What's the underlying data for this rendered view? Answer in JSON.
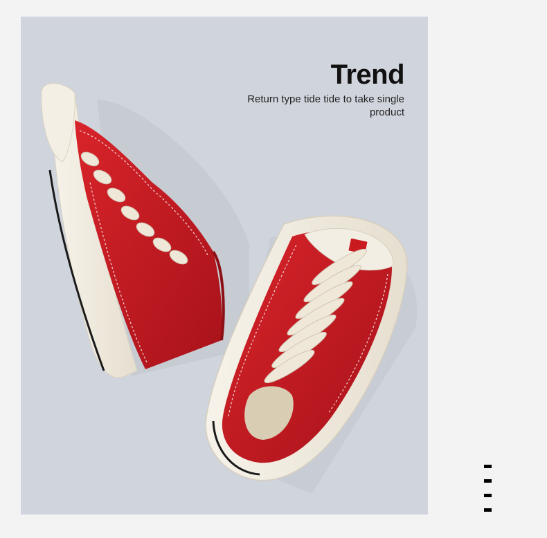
{
  "headline": "Trend",
  "tagline": "Return type tide tide to take single product",
  "colors": {
    "page_background": "#f3f3f3",
    "panel_background": "#d0d4dc",
    "shoe_red": "#c91a1f",
    "sole_cream": "#f3eee3",
    "lace_cream": "#efe7d8"
  },
  "photo": {
    "subject": "pair of red canvas high-top sneakers"
  },
  "indicator": {
    "dash_count": 4
  }
}
